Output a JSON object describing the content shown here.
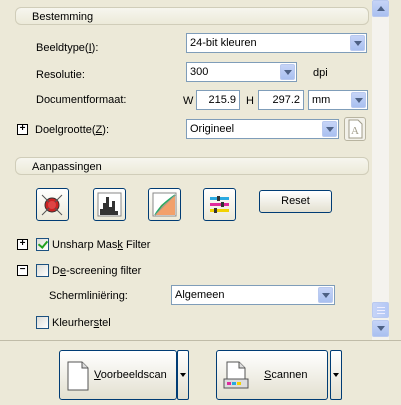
{
  "sections": {
    "bestemming": "Bestemming",
    "aanpassingen": "Aanpassingen"
  },
  "beeldtype": {
    "label_pre": "Beeldtype(",
    "label_key": "I",
    "label_post": "):",
    "value": "24-bit kleuren"
  },
  "resolutie": {
    "label": "Resolutie:",
    "value": "300",
    "unit": "dpi"
  },
  "documentformaat": {
    "label": "Documentformaat:",
    "w_label": "W",
    "w_value": "215.9",
    "h_label": "H",
    "h_value": "297.2",
    "unit": "mm"
  },
  "doelgrootte": {
    "label_pre": "Doelgrootte(",
    "label_key": "Z",
    "label_post": "):",
    "value": "Origineel"
  },
  "reset_label": "Reset",
  "unsharp": {
    "label_pre": "Unsharp Mas",
    "label_key": "k",
    "label_post": " Filter",
    "checked": true
  },
  "descreening": {
    "label_pre": "D",
    "label_key": "e",
    "label_post": "-screening filter",
    "checked": false
  },
  "schermliniering": {
    "label": "Schermliniëring:",
    "value": "Algemeen"
  },
  "kleurherstel": {
    "label_pre": "Kleurher",
    "label_key": "s",
    "label_post": "tel",
    "checked": false
  },
  "buttons": {
    "preview_pre": "",
    "preview_key": "V",
    "preview_post": "oorbeeldscan",
    "scan_pre": "",
    "scan_key": "S",
    "scan_post": "cannen"
  },
  "icons": [
    "auto-exposure-icon",
    "histogram-icon",
    "tone-curve-icon",
    "color-balance-icon",
    "document-icon",
    "scanner-icon"
  ],
  "colors": {
    "accent": "#003c74",
    "panel": "#ece9d8",
    "field_border": "#7f9db9"
  }
}
